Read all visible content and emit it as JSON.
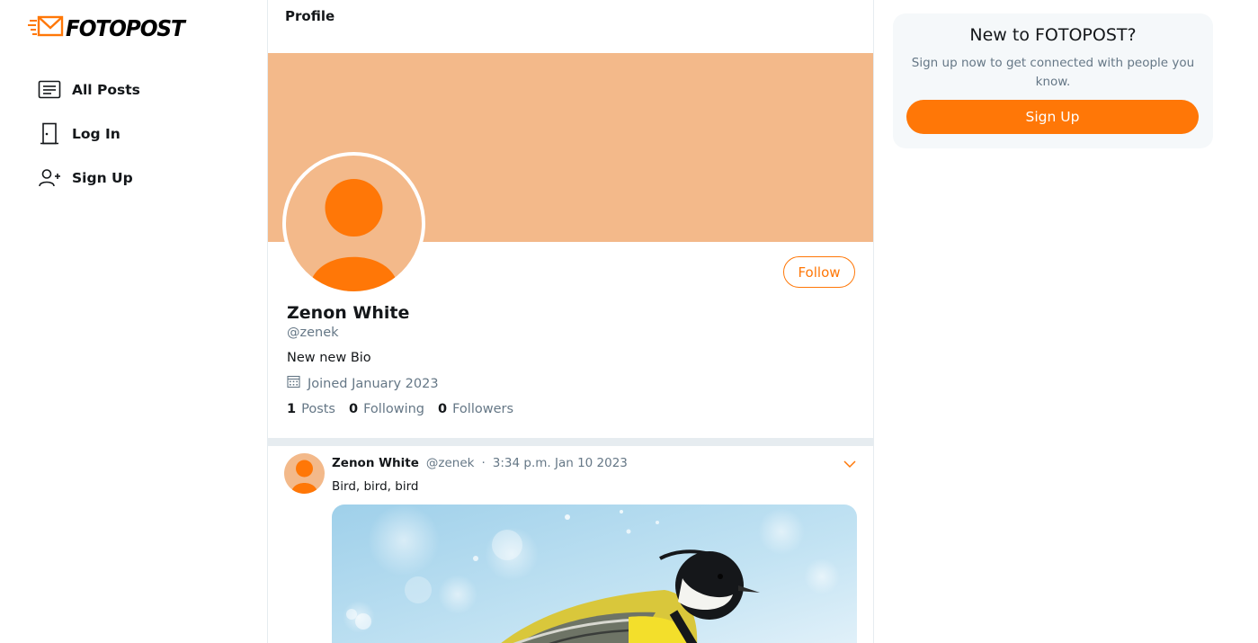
{
  "brand": {
    "name": "FOTOPOST",
    "accent": "#ff7707",
    "banner_color": "#f3b98a"
  },
  "sidebar": {
    "items": [
      {
        "label": "All Posts",
        "icon": "newspaper-icon"
      },
      {
        "label": "Log In",
        "icon": "door-icon"
      },
      {
        "label": "Sign Up",
        "icon": "add-user-icon"
      }
    ]
  },
  "header": {
    "title": "Profile"
  },
  "profile": {
    "name": "Zenon White",
    "handle": "@zenek",
    "bio": "New new Bio",
    "joined": "Joined January 2023",
    "follow_label": "Follow",
    "stats": {
      "posts_count": "1",
      "posts_label": "Posts",
      "following_count": "0",
      "following_label": "Following",
      "followers_count": "0",
      "followers_label": "Followers"
    }
  },
  "post": {
    "author": "Zenon White",
    "handle": "@zenek",
    "separator": "·",
    "time": "3:34 p.m. Jan 10 2023",
    "text": "Bird, bird, bird",
    "image": "bird-photo"
  },
  "promo": {
    "title": "New to FOTOPOST?",
    "text": "Sign up now to get connected with people you know.",
    "button": "Sign Up"
  }
}
